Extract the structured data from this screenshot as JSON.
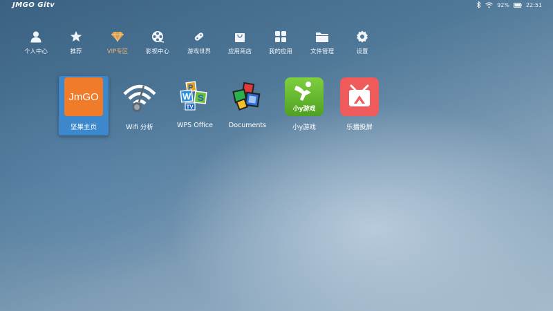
{
  "statusbar": {
    "brand_main": "JMGO",
    "brand_sub": "Gitv",
    "battery": "92%",
    "time": "22:51",
    "icons": [
      "bluetooth-icon",
      "wifi-icon",
      "battery-icon"
    ]
  },
  "nav": [
    {
      "label": "个人中心",
      "icon": "person-icon"
    },
    {
      "label": "推荐",
      "icon": "star-icon"
    },
    {
      "label": "VIP专区",
      "icon": "diamond-icon"
    },
    {
      "label": "影视中心",
      "icon": "film-reel-icon"
    },
    {
      "label": "游戏世界",
      "icon": "gamepad-icon"
    },
    {
      "label": "应用商店",
      "icon": "shopping-bag-icon"
    },
    {
      "label": "我的应用",
      "icon": "grid-icon"
    },
    {
      "label": "文件管理",
      "icon": "folder-icon"
    },
    {
      "label": "设置",
      "icon": "gear-icon"
    }
  ],
  "apps": [
    {
      "label": "坚果主页",
      "tile_text": "JmGO",
      "focused": true,
      "icon": "jmgo-app-icon"
    },
    {
      "label": "Wifi 分析",
      "icon": "wifi-analyzer-app-icon"
    },
    {
      "label": "WPS Office",
      "tile_text": "WPS",
      "icon": "wps-office-app-icon"
    },
    {
      "label": "Documents",
      "icon": "documents-app-icon"
    },
    {
      "label": "小y游戏",
      "tile_text": "小y游戏",
      "icon": "small-y-games-app-icon"
    },
    {
      "label": "乐播投屏",
      "icon": "lebo-cast-app-icon"
    }
  ],
  "colors": {
    "accent_blue": "#3d87cc",
    "vip_gold": "#e6b46a",
    "jmgo_orange": "#f07c2a",
    "game_green": "#6cc033",
    "lebo_red": "#ef5a5a"
  }
}
